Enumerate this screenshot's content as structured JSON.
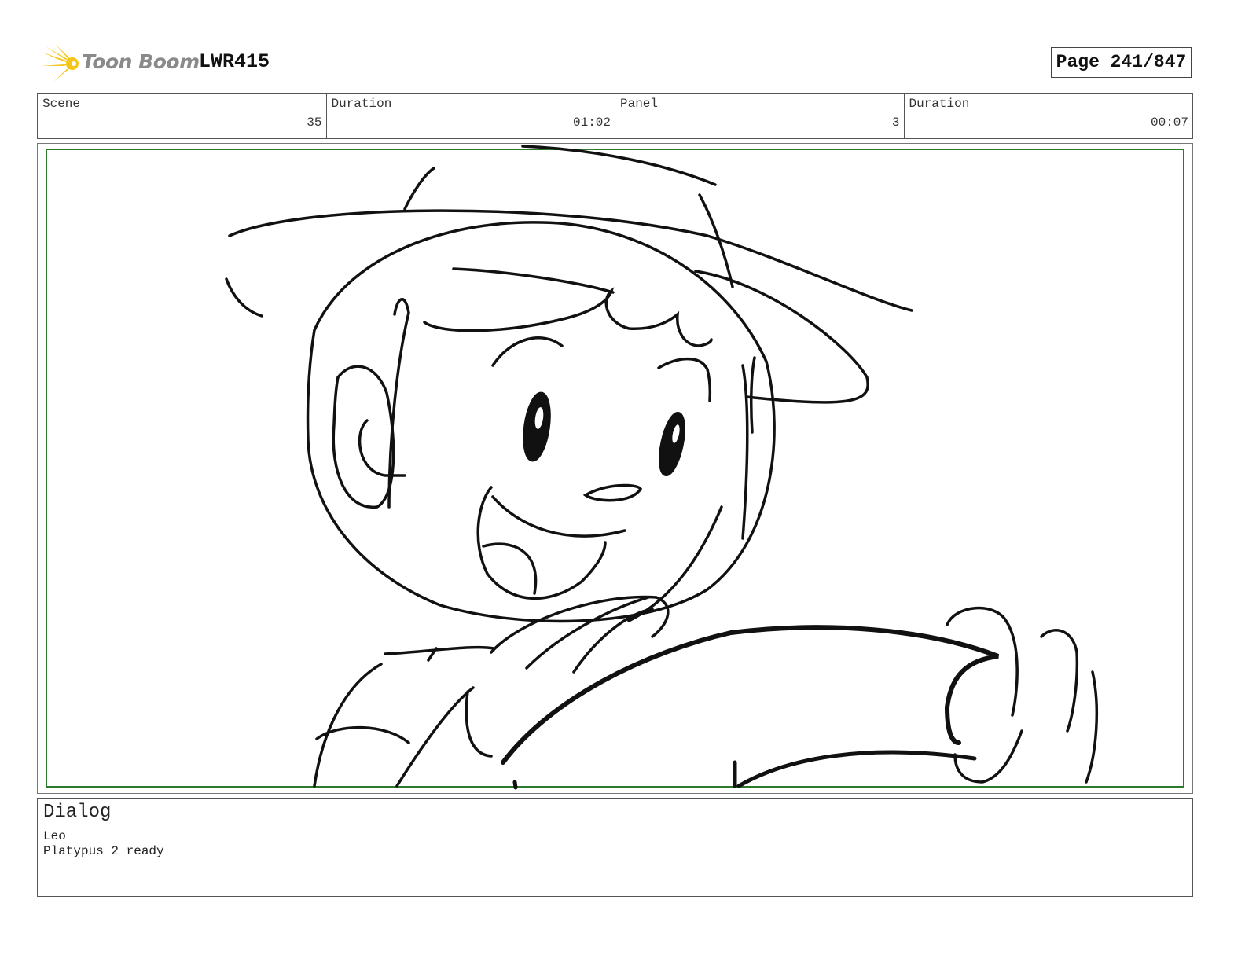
{
  "header": {
    "logo_text": "Toon Boom",
    "project": "LWR415",
    "page": "Page 241/847"
  },
  "info": {
    "scene_label": "Scene",
    "scene_value": "35",
    "scene_duration_label": "Duration",
    "scene_duration_value": "01:02",
    "panel_label": "Panel",
    "panel_value": "3",
    "panel_duration_label": "Duration",
    "panel_duration_value": "00:07"
  },
  "dialog": {
    "title": "Dialog",
    "speaker": "Leo",
    "text": "Platypus 2 ready"
  },
  "colors": {
    "safe_frame": "#2d7a2d",
    "logo_star": "#f5c518"
  }
}
